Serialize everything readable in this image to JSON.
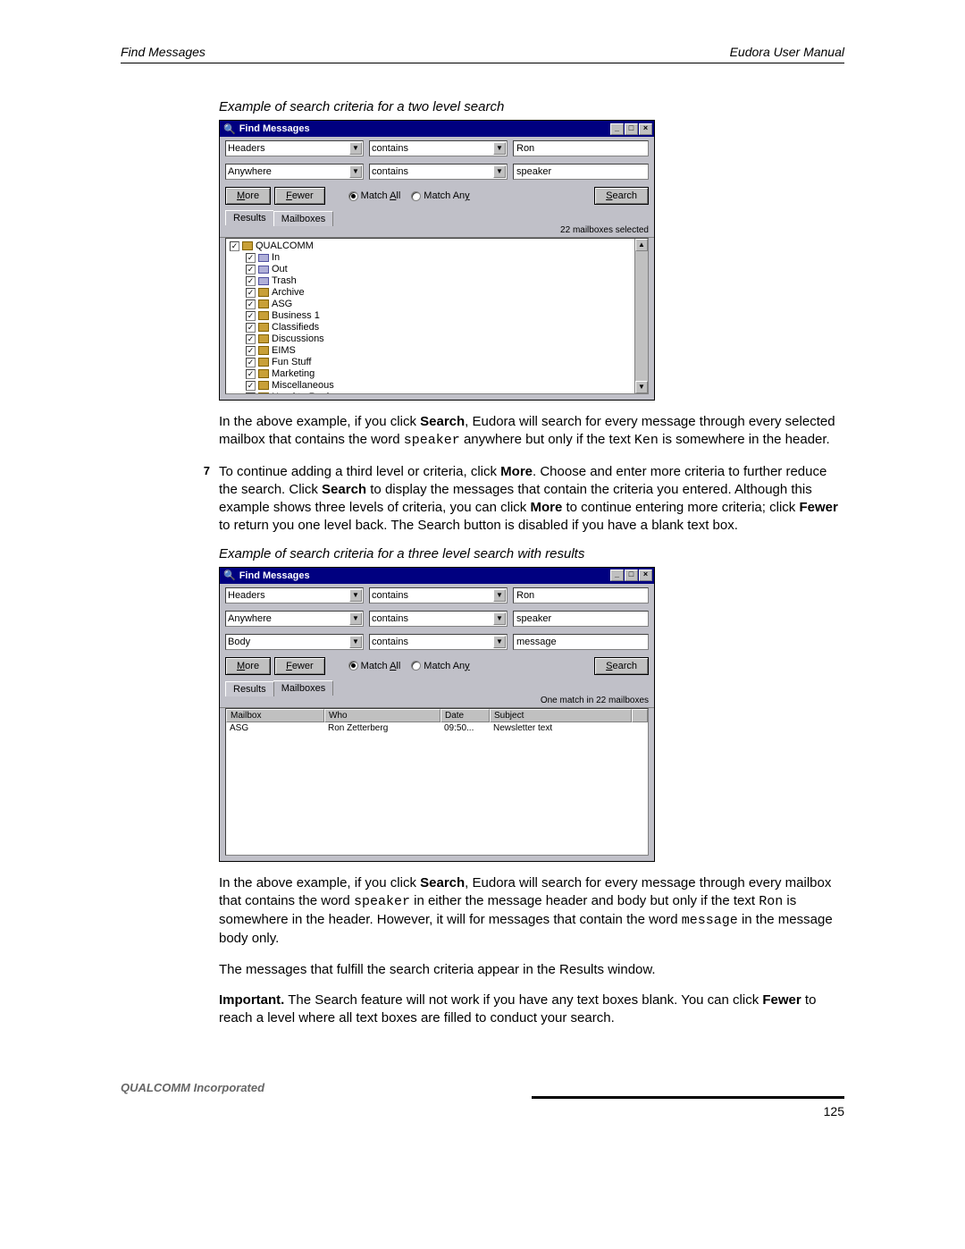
{
  "header": {
    "left": "Find Messages",
    "right": "Eudora User Manual"
  },
  "caption1": "Example of search criteria for a two level search",
  "caption2": "Example of search criteria for a three level search with results",
  "dialog": {
    "title": "Find Messages",
    "rows": [
      {
        "field": "Headers",
        "op": "contains",
        "value": "Ron"
      },
      {
        "field": "Anywhere",
        "op": "contains",
        "value": "speaker"
      }
    ],
    "rows3": [
      {
        "field": "Headers",
        "op": "contains",
        "value": "Ron"
      },
      {
        "field": "Anywhere",
        "op": "contains",
        "value": "speaker"
      },
      {
        "field": "Body",
        "op": "contains",
        "value": "message"
      }
    ],
    "buttons": {
      "more": "More",
      "fewer": "Fewer",
      "search": "Search"
    },
    "match_all": "Match All",
    "match_any": "Match Any",
    "tabs": {
      "results": "Results",
      "mailboxes": "Mailboxes"
    },
    "status1": "22 mailboxes selected",
    "status2": "One match in 22 mailboxes",
    "tree": {
      "root": "QUALCOMM",
      "items": [
        "In",
        "Out",
        "Trash",
        "Archive",
        "ASG",
        "Business 1",
        "Classifieds",
        "Discussions",
        "EIMS",
        "Fun Stuff",
        "Marketing",
        "Miscellaneous",
        "Need to Reply"
      ]
    },
    "columns": {
      "mailbox": "Mailbox",
      "who": "Who",
      "date": "Date",
      "subject": "Subject"
    },
    "result": {
      "mailbox": "ASG",
      "who": "Ron Zetterberg",
      "date": "09:50...",
      "subject": "Newsletter text"
    }
  },
  "para1_a": "In the above example, if you click ",
  "para1_b": "Search",
  "para1_c": ", Eudora will search for every message through every selected mailbox that contains the word ",
  "para1_d": "speaker",
  "para1_e": " anywhere but only if the text ",
  "para1_f": "Ken",
  "para1_g": " is somewhere in the header.",
  "step7": {
    "num": "7",
    "t1": "To continue adding a third level or criteria, click ",
    "t2": "More",
    "t3": ". Choose and enter more criteria to further reduce the search. Click ",
    "t4": "Search",
    "t5": " to display the messages that contain the criteria you entered. Although this example shows three levels of criteria, you can click ",
    "t6": "More",
    "t7": " to continue entering more criteria; click ",
    "t8": "Fewer",
    "t9": " to return you one level back. The Search button is disabled if you have a blank text box."
  },
  "para2_a": "In the above example, if you click ",
  "para2_b": "Search",
  "para2_c": ", Eudora will search for every message through every mailbox that contains the word ",
  "para2_d": "speaker",
  "para2_e": " in either the message header and body but only if the text ",
  "para2_f": "Ron",
  "para2_g": " is somewhere in the header. However, it will for messages that contain the word ",
  "para2_h": "message",
  "para2_i": " in the message body only.",
  "para3": "The messages that fulfill the search criteria appear in the Results window.",
  "para4_a": "Important.",
  "para4_b": " The Search feature will not work if you have any text boxes blank. You can click ",
  "para4_c": "Fewer",
  "para4_d": " to reach a level where all text boxes are filled to conduct your search.",
  "footer": {
    "company": "QUALCOMM Incorporated",
    "page": "125"
  }
}
